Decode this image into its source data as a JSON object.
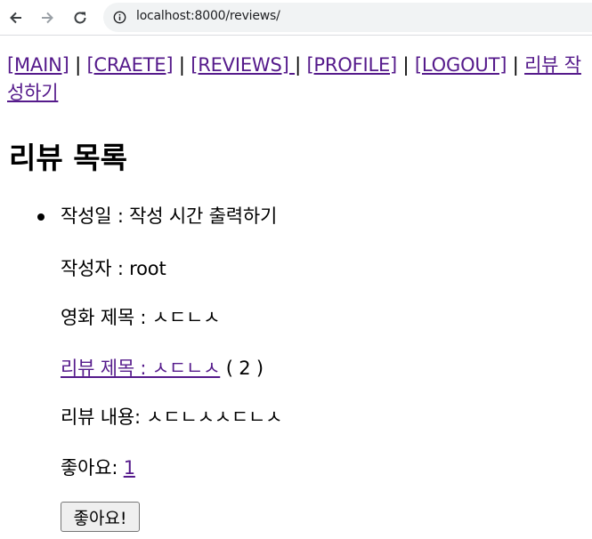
{
  "browser": {
    "url": "localhost:8000/reviews/"
  },
  "nav": {
    "main": "[MAIN]",
    "create": "[CRAETE]",
    "reviews": "[REVIEWS] ",
    "profile": "[PROFILE]",
    "logout": "[LOGOUT]",
    "write_review": "리뷰 작성하기",
    "separator": "|"
  },
  "page": {
    "title": "리뷰 목록"
  },
  "review": {
    "created_label": "작성일 : 작성 시간 출력하기",
    "author_label": "작성자 : root",
    "movie_title_label": "영화 제목 : ㅅㄷㄴㅅ",
    "review_title_link": "리뷰 제목 : ㅅㄷㄴㅅ",
    "review_count": " ( 2 )",
    "content_label": "리뷰 내용: ㅅㄷㄴㅅㅅㄷㄴㅅ",
    "likes_label": "좋아요: ",
    "likes_count": "1",
    "like_button": "좋아요!"
  }
}
